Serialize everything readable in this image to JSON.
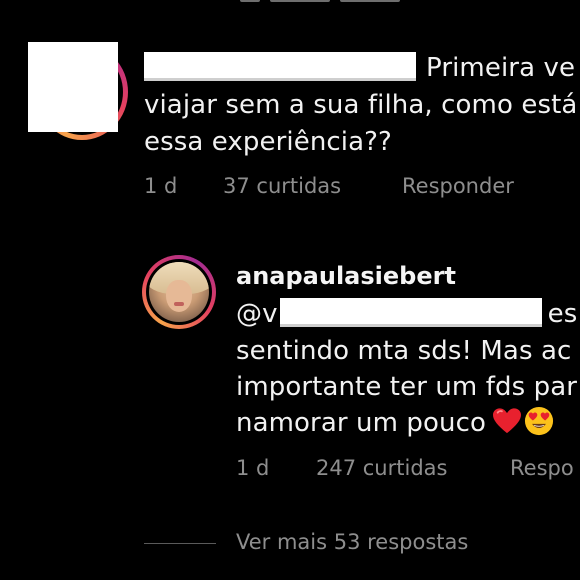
{
  "comment": {
    "username_redacted": true,
    "text_line1": "Primeira ve",
    "text_line2": "viajar sem a sua filha, como está",
    "text_line3": "essa experiência??",
    "time": "1 d",
    "likes": "37 curtidas",
    "reply_label": "Responder"
  },
  "reply": {
    "username": "anapaulasiebert",
    "mention_prefix": "@v",
    "text_line1_tail": "es",
    "text_line2": "sentindo mta sds! Mas ac",
    "text_line3": "importante ter um fds par",
    "text_line4": "namorar um pouco",
    "emojis": [
      "red-heart-icon",
      "heart-eyes-icon"
    ],
    "time": "1 d",
    "likes": "247 curtidas",
    "reply_label": "Respo"
  },
  "view_more": "Ver mais 53 respostas",
  "colors": {
    "background": "#000000",
    "primary_text": "#f5f5f5",
    "secondary_text": "#8e8e8e",
    "story_ring_start": "#f7a34b",
    "story_ring_end": "#b22a8e"
  }
}
